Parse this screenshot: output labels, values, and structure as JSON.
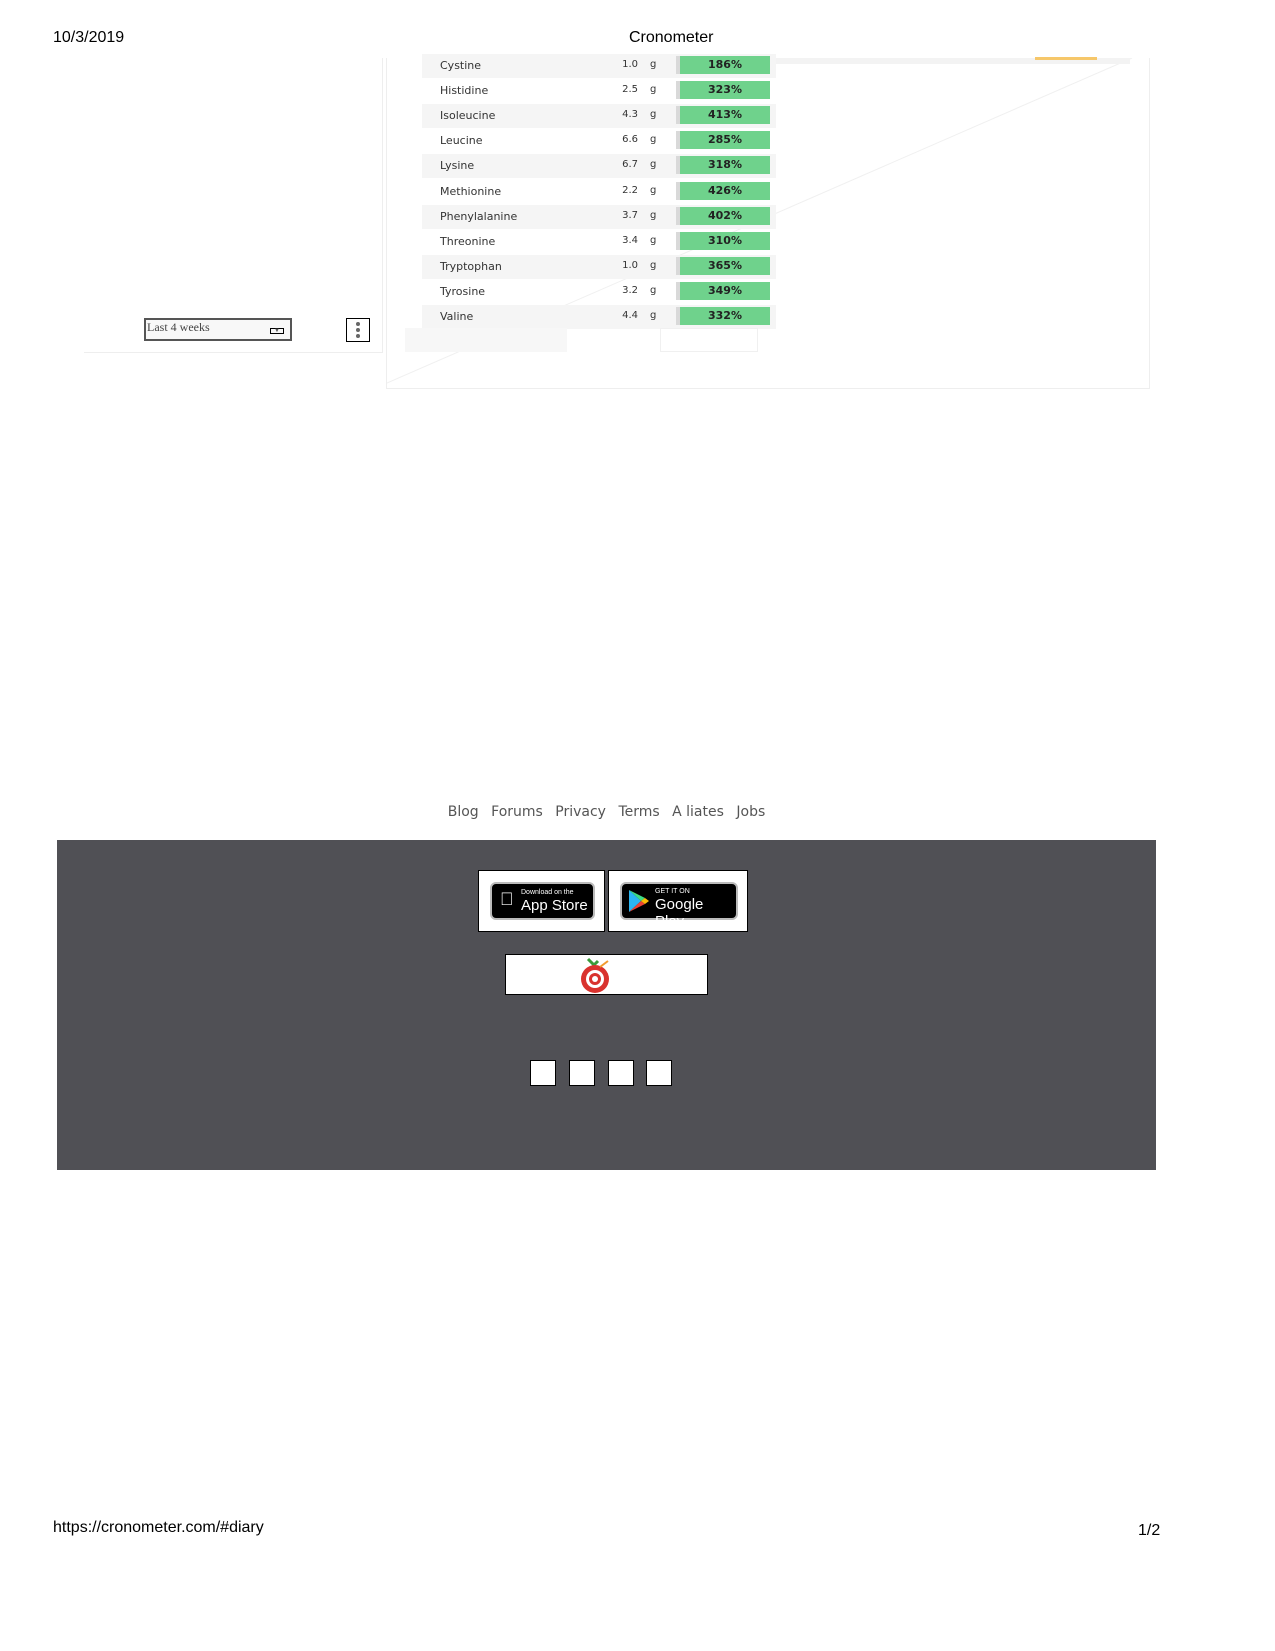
{
  "page_header": {
    "date": "10/3/2019",
    "title": "Cronometer"
  },
  "page_footer": {
    "url": "https://cronometer.com/#diary",
    "page": "1/2"
  },
  "range_select": {
    "value": "Last 4 weeks"
  },
  "amino_acids": [
    {
      "name": "Cystine",
      "amount": "1.0",
      "unit": "g",
      "percent": "186%"
    },
    {
      "name": "Histidine",
      "amount": "2.5",
      "unit": "g",
      "percent": "323%"
    },
    {
      "name": "Isoleucine",
      "amount": "4.3",
      "unit": "g",
      "percent": "413%"
    },
    {
      "name": "Leucine",
      "amount": "6.6",
      "unit": "g",
      "percent": "285%"
    },
    {
      "name": "Lysine",
      "amount": "6.7",
      "unit": "g",
      "percent": "318%"
    },
    {
      "name": "Methionine",
      "amount": "2.2",
      "unit": "g",
      "percent": "426%"
    },
    {
      "name": "Phenylalanine",
      "amount": "3.7",
      "unit": "g",
      "percent": "402%"
    },
    {
      "name": "Threonine",
      "amount": "3.4",
      "unit": "g",
      "percent": "310%"
    },
    {
      "name": "Tryptophan",
      "amount": "1.0",
      "unit": "g",
      "percent": "365%"
    },
    {
      "name": "Tyrosine",
      "amount": "3.2",
      "unit": "g",
      "percent": "349%"
    },
    {
      "name": "Valine",
      "amount": "4.4",
      "unit": "g",
      "percent": "332%"
    }
  ],
  "footer_links": [
    "Blog",
    "Forums",
    "Privacy",
    "Terms",
    "A liates",
    "Jobs"
  ],
  "app_store": {
    "small": "Download on the",
    "big": "App Store"
  },
  "google_play": {
    "small": "GET IT ON",
    "big": "Google Play"
  },
  "colors": {
    "bar": "#6fd28c",
    "footer_bg": "#505055"
  }
}
